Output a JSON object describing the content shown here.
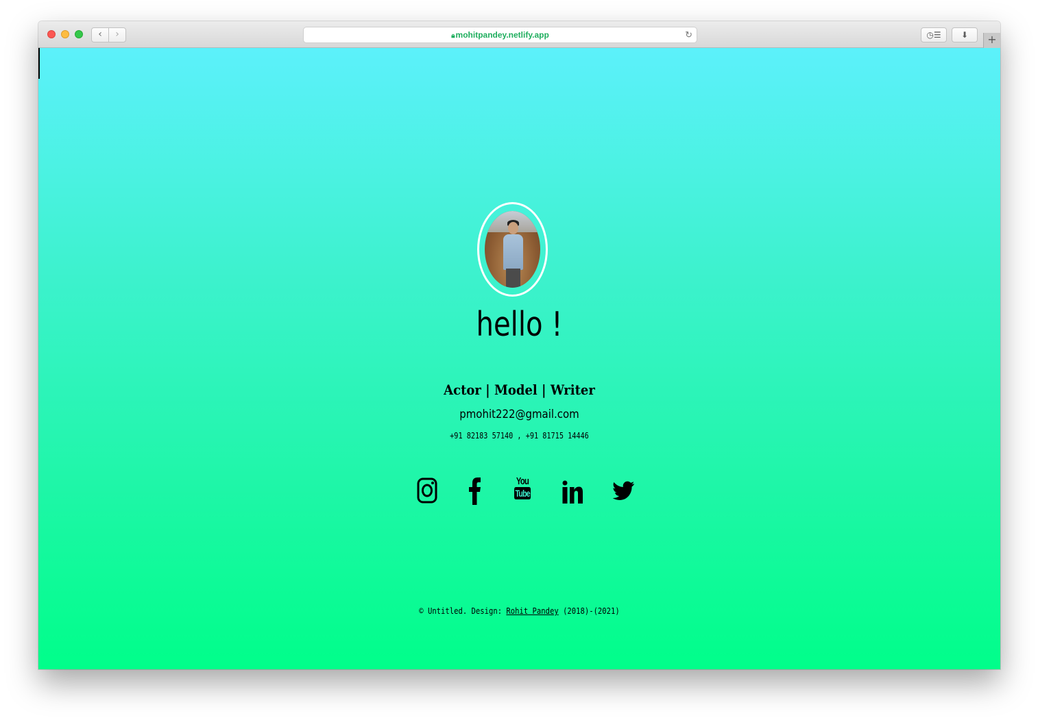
{
  "browser": {
    "url": "mohitpandey.netlify.app",
    "nav_back": "‹",
    "nav_forward": "›",
    "reload_glyph": "↻",
    "reader_glyph": "◷☰",
    "download_glyph": "⬇",
    "newtab_glyph": "+"
  },
  "profile": {
    "greeting": "hello !",
    "roles": "Actor | Model | Writer",
    "email": "pmohit222@gmail.com",
    "phones": "+91 82183 57140 , +91 81715 14446"
  },
  "social": {
    "items": [
      {
        "name": "instagram-icon"
      },
      {
        "name": "facebook-icon"
      },
      {
        "name": "youtube-icon",
        "text_top": "You",
        "text_bottom": "Tube"
      },
      {
        "name": "linkedin-icon"
      },
      {
        "name": "twitter-icon"
      }
    ]
  },
  "footer": {
    "prefix": "© Untitled. Design: ",
    "designer": "Rohit Pandey",
    "suffix": " (2018)-(2021)"
  },
  "colors": {
    "gradient_top": "#5cf1fb",
    "gradient_bottom": "#00fe8a",
    "url_text": "#1fae5e"
  }
}
